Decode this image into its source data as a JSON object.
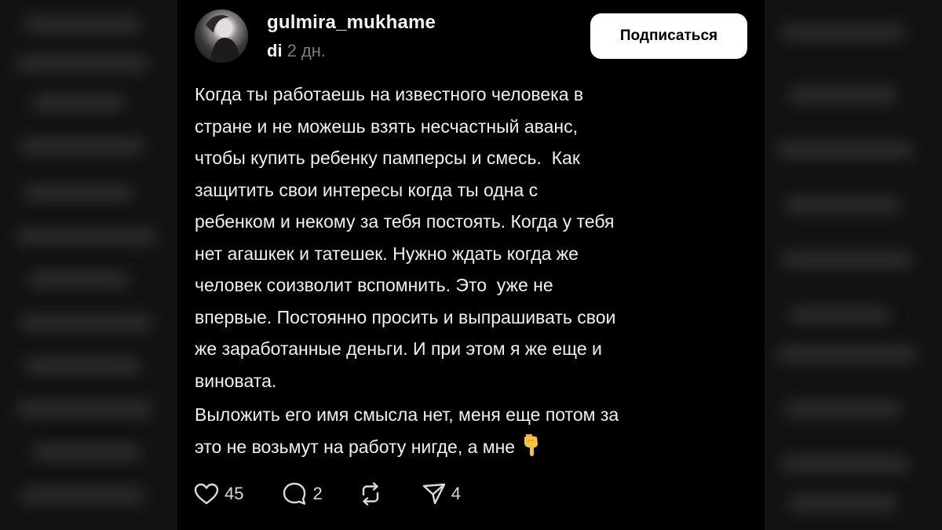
{
  "post": {
    "username": "gulmira_mukhame",
    "handle": "di",
    "time": "2 дн.",
    "subscribe_label": "Подписаться",
    "paragraphs": [
      "Когда ты работаешь на известного человека в\nстране и не можешь взять несчастный аванс,\nчтобы купить ребенку памперсы и смесь.  Как\nзащитить свои интересы когда ты одна с\nребенком и некому за тебя постоять. Когда у тебя\nнет агашкек и татешек. Нужно ждать когда же\nчеловек соизволит вспомнить. Это  уже не\nвпервые. Постоянно просить и выпрашивать свои\nже заработанные деньги. И при этом я же еще и\nвиновата.",
      "Выложить его имя смысла нет, меня еще потом за\nэто не возьмут на работу нигде, а мне"
    ],
    "emoji": "pointing-down-hand-icon",
    "actions": {
      "likes": "45",
      "replies": "2",
      "reposts": "",
      "shares": "4"
    }
  },
  "colors": {
    "background": "#000000",
    "text": "#f0f0f0",
    "muted": "#7d7d7d",
    "button_bg": "#ffffff"
  }
}
